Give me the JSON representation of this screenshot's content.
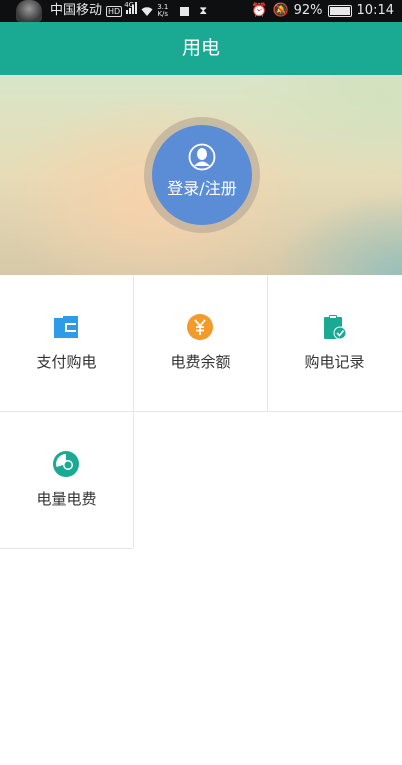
{
  "status_bar": {
    "carrier": "中国移动",
    "hd_badge": "HD",
    "network": "4G",
    "speed_value": "3.1",
    "speed_unit": "K/s",
    "battery": "92%",
    "time": "10:14"
  },
  "header": {
    "title": "用电"
  },
  "banner": {
    "login_label": "登录/注册"
  },
  "menu": {
    "items": [
      {
        "label": "支付购电",
        "icon": "wallet-icon",
        "color": "#2e9be8"
      },
      {
        "label": "电费余额",
        "icon": "yuan-coin-icon",
        "color": "#f39a2b"
      },
      {
        "label": "购电记录",
        "icon": "clipboard-check-icon",
        "color": "#1aa993"
      },
      {
        "label": "电量电费",
        "icon": "pie-chart-icon",
        "color": "#1aa993"
      }
    ]
  },
  "colors": {
    "header": "#1aa993",
    "login_button": "#5b8dd6"
  }
}
